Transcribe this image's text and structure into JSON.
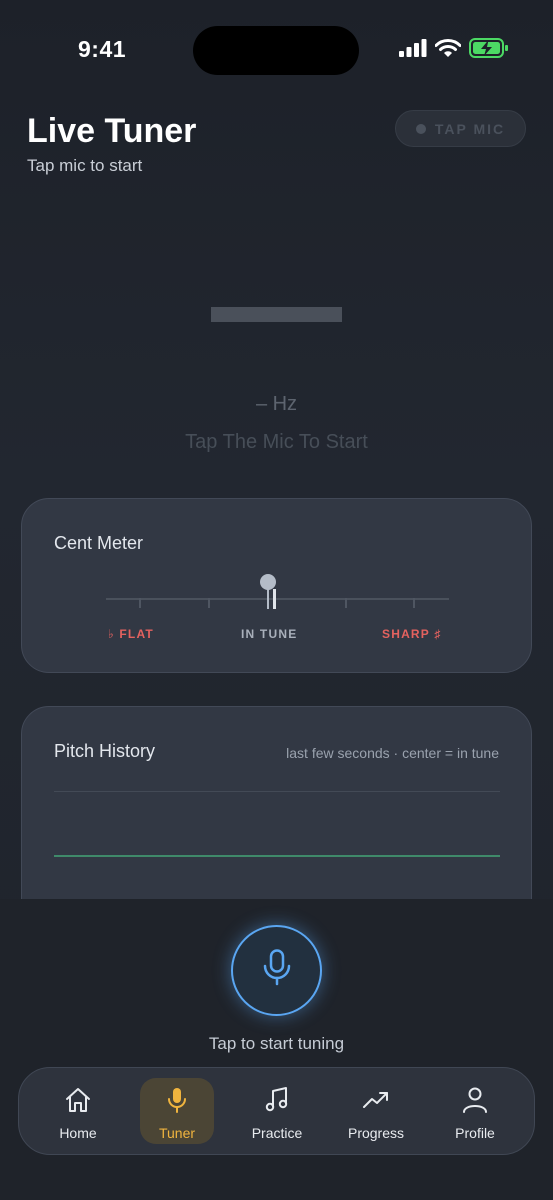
{
  "status_bar": {
    "time": "9:41",
    "icons": [
      "signal-icon",
      "wifi-icon",
      "battery-charging-icon"
    ]
  },
  "header": {
    "title": "Live Tuner",
    "subtitle": "Tap mic to start",
    "tap_mic_label": "TAP MIC"
  },
  "readout": {
    "hz": "–  Hz",
    "status": "Tap The Mic To Start"
  },
  "cent_meter": {
    "title": "Cent Meter",
    "flat_label": "♭ FLAT",
    "in_tune_label": "IN TUNE",
    "sharp_label": "SHARP ♯",
    "cents_offset": 0
  },
  "pitch_history": {
    "title": "Pitch History",
    "hint": "last few seconds · center = in tune"
  },
  "mic": {
    "prompt": "Tap to start tuning"
  },
  "tab_bar": {
    "tabs": [
      {
        "label": "Home",
        "icon": "home-icon",
        "active": false
      },
      {
        "label": "Tuner",
        "icon": "mic-icon",
        "active": true
      },
      {
        "label": "Practice",
        "icon": "music-note-icon",
        "active": false
      },
      {
        "label": "Progress",
        "icon": "trend-up-icon",
        "active": false
      },
      {
        "label": "Profile",
        "icon": "user-icon",
        "active": false
      }
    ]
  },
  "colors": {
    "accent_mic": "#5aa6f2",
    "accent_active_tab": "#f0b43e",
    "flat_sharp": "#e4625f",
    "history_line": "#3f8a6a"
  }
}
